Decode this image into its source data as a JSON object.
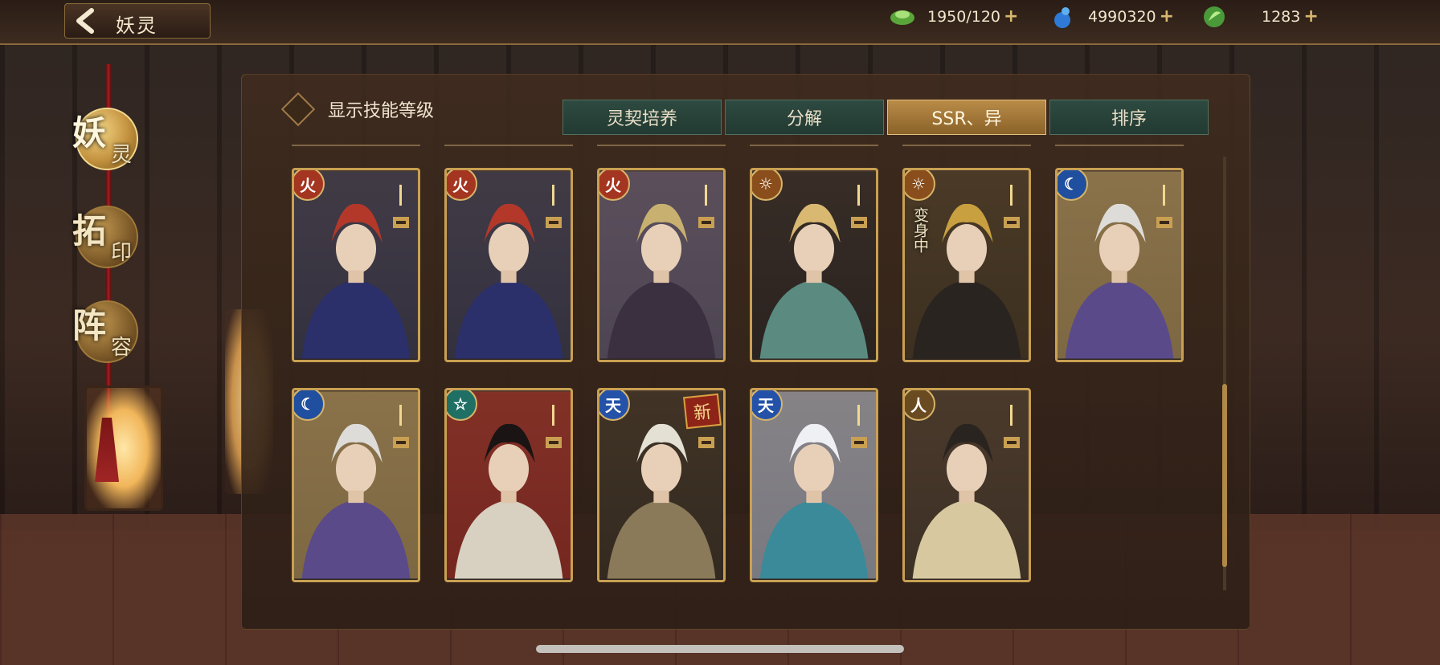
{
  "header": {
    "title": "妖灵",
    "back_icon": "chevron-left-icon",
    "resources": [
      {
        "name": "jade-icon",
        "value": "1950/120",
        "color": "#6fb84a"
      },
      {
        "name": "blue-gourd-icon",
        "value": "4990320",
        "color": "#3a8fe0"
      },
      {
        "name": "leaf-coin-icon",
        "value": "1283",
        "color": "#72c04e"
      }
    ]
  },
  "sidebar": {
    "items": [
      {
        "big": "妖",
        "small": "灵",
        "active": true
      },
      {
        "big": "拓",
        "small": "印",
        "active": false
      },
      {
        "big": "阵",
        "small": "容",
        "active": false
      }
    ]
  },
  "toolbar": {
    "skill_toggle_label": "显示技能等级",
    "tabs": [
      {
        "label": "灵契培养",
        "active": false
      },
      {
        "label": "分解",
        "active": false
      },
      {
        "label": "SSR、异",
        "active": true
      },
      {
        "label": "排序",
        "active": false
      }
    ]
  },
  "cards": [
    {
      "element": "火",
      "element_kind": "fire",
      "palette": [
        "#b4382a",
        "#2b2f6a",
        "#3a3c5a"
      ]
    },
    {
      "element": "火",
      "element_kind": "fire",
      "palette": [
        "#b4382a",
        "#2b2f6a",
        "#3a3c5a"
      ]
    },
    {
      "element": "火",
      "element_kind": "fire",
      "palette": [
        "#c8b070",
        "#3a3040",
        "#6a6080"
      ]
    },
    {
      "element": "☼",
      "element_kind": "sun",
      "palette": [
        "#d9b872",
        "#5a8a80",
        "#2a2220"
      ]
    },
    {
      "element": "☼",
      "element_kind": "sun",
      "palette": [
        "#c8a040",
        "#2a2420",
        "#4a3a20"
      ],
      "status": "变身中"
    },
    {
      "element": "☾",
      "element_kind": "moon",
      "palette": [
        "#dedcd8",
        "#5a4a8a",
        "#c0a060"
      ]
    },
    {
      "element": "☾",
      "element_kind": "moon",
      "palette": [
        "#dedcd8",
        "#5a4a8a",
        "#c0a060"
      ]
    },
    {
      "element": "☆",
      "element_kind": "star",
      "palette": [
        "#1a1414",
        "#d8d0c0",
        "#b02a20"
      ]
    },
    {
      "element": "天",
      "element_kind": "sky",
      "palette": [
        "#e4e0d4",
        "#8a7a5a",
        "#3a3020"
      ],
      "new": "新"
    },
    {
      "element": "天",
      "element_kind": "sky",
      "palette": [
        "#eef0f4",
        "#3a8a9a",
        "#b8c0d0"
      ]
    },
    {
      "element": "人",
      "element_kind": "person",
      "palette": [
        "#2a2420",
        "#d8c8a0",
        "#4a3a2a"
      ]
    }
  ]
}
